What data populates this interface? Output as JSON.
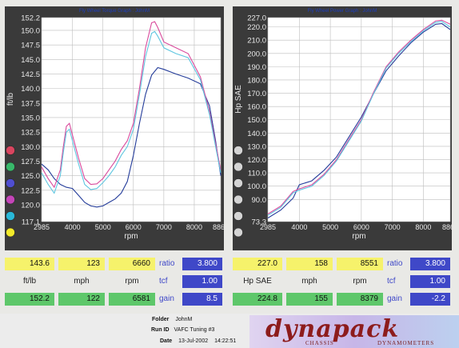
{
  "colors": {
    "panel_bg": "#3a3a3a",
    "plot_bg": "#ffffff",
    "series_1": "#243c9a",
    "series_2": "#d94a9c",
    "series_3": "#5fc6e0",
    "title_color": "#1f3fbf",
    "yellow": "#f6f26b",
    "green": "#5ec76a",
    "blue": "#3f48c8"
  },
  "legend_dots": [
    "#d9455f",
    "#38b86a",
    "#4f4ed0",
    "#c445b8",
    "#29b8d8",
    "#f2ea2a"
  ],
  "chart_data": [
    {
      "type": "line",
      "title": "Fly Wheel Torque Graph : JohnM",
      "xlabel": "rpm",
      "ylabel": "ft/lb",
      "xlim": [
        2985,
        8868
      ],
      "ylim": [
        117.1,
        152.2
      ],
      "x_ticks": [
        2985,
        4000,
        5000,
        6000,
        7000,
        8000,
        8868
      ],
      "x_tick_labels": [
        "2985",
        "4000",
        "5000",
        "6000",
        "7000",
        "8000",
        "8868"
      ],
      "y_ticks": [
        117.1,
        120.0,
        122.5,
        125.0,
        127.5,
        130.0,
        132.5,
        135.0,
        137.5,
        140.0,
        142.5,
        145.0,
        147.5,
        150.0,
        152.2
      ],
      "y_tick_labels": [
        "117.1",
        "120.0",
        "122.5",
        "125.0",
        "127.5",
        "130.0",
        "132.5",
        "135.0",
        "137.5",
        "140.0",
        "142.5",
        "145.0",
        "147.5",
        "150.0",
        "152.2"
      ],
      "grid": true,
      "series": [
        {
          "color": "#243c9a",
          "x": [
            2985,
            3200,
            3400,
            3600,
            3800,
            4000,
            4200,
            4400,
            4600,
            4800,
            5000,
            5200,
            5400,
            5600,
            5800,
            6000,
            6200,
            6400,
            6600,
            6800,
            7000,
            7400,
            7800,
            8200,
            8500,
            8700,
            8868
          ],
          "y": [
            127.0,
            126.0,
            124.5,
            123.5,
            123.0,
            122.8,
            121.6,
            120.4,
            119.8,
            119.6,
            119.8,
            120.4,
            121.0,
            122.0,
            124.0,
            128.5,
            134.0,
            139.0,
            142.3,
            143.6,
            143.3,
            142.5,
            141.8,
            140.8,
            137.0,
            131.0,
            125.0
          ]
        },
        {
          "color": "#d94a9c",
          "x": [
            2985,
            3200,
            3400,
            3600,
            3700,
            3800,
            3900,
            4000,
            4200,
            4400,
            4600,
            4800,
            5000,
            5200,
            5400,
            5600,
            5800,
            6000,
            6200,
            6400,
            6600,
            6700,
            6800,
            7000,
            7400,
            7800,
            8200,
            8500,
            8700,
            8868
          ],
          "y": [
            126.5,
            124.5,
            123.0,
            126.0,
            130.0,
            133.5,
            134.0,
            132.0,
            128.0,
            124.5,
            123.5,
            123.6,
            124.5,
            126.0,
            127.5,
            129.5,
            131.0,
            134.0,
            140.0,
            147.0,
            151.3,
            151.5,
            150.5,
            148.0,
            147.0,
            146.0,
            142.0,
            136.0,
            130.5,
            126.0
          ]
        },
        {
          "color": "#5fc6e0",
          "x": [
            2985,
            3200,
            3400,
            3600,
            3700,
            3800,
            3900,
            4000,
            4200,
            4400,
            4600,
            4800,
            5000,
            5200,
            5400,
            5600,
            5800,
            6000,
            6200,
            6400,
            6600,
            6700,
            6800,
            7000,
            7400,
            7800,
            8200,
            8500,
            8700,
            8868
          ],
          "y": [
            125.5,
            123.5,
            122.0,
            125.0,
            129.0,
            132.5,
            133.0,
            131.0,
            127.0,
            123.5,
            122.6,
            122.8,
            123.8,
            125.0,
            126.5,
            128.5,
            130.0,
            133.0,
            139.0,
            145.5,
            149.5,
            149.8,
            149.0,
            147.0,
            146.0,
            145.3,
            141.5,
            135.5,
            130.0,
            125.5
          ]
        }
      ]
    },
    {
      "type": "line",
      "title": "Fly Wheel Power Graph : JohnM",
      "xlabel": "rpm",
      "ylabel": "Hp SAE",
      "xlim": [
        2985,
        8868
      ],
      "ylim": [
        73.3,
        227.0
      ],
      "x_ticks": [
        2985,
        4000,
        5000,
        6000,
        7000,
        8000,
        8868
      ],
      "x_tick_labels": [
        "2985",
        "4000",
        "5000",
        "6000",
        "7000",
        "8000",
        "8868"
      ],
      "y_ticks": [
        73.3,
        90.0,
        100.0,
        110.0,
        120.0,
        130.0,
        140.0,
        150.0,
        160.0,
        170.0,
        180.0,
        190.0,
        200.0,
        210.0,
        220.0,
        227.0
      ],
      "y_tick_labels": [
        "73.3",
        "90.0",
        "100.0",
        "110.0",
        "120.0",
        "130.0",
        "140.0",
        "150.0",
        "160.0",
        "170.0",
        "180.0",
        "190.0",
        "200.0",
        "210.0",
        "220.0",
        "227.0"
      ],
      "grid": true,
      "series": [
        {
          "color": "#243c9a",
          "x": [
            2985,
            3400,
            3800,
            4000,
            4400,
            4800,
            5200,
            5600,
            6000,
            6400,
            6800,
            7200,
            7600,
            8000,
            8400,
            8600,
            8868
          ],
          "y": [
            76.0,
            82.0,
            91.0,
            101.0,
            104.0,
            112.0,
            122.0,
            137.0,
            152.0,
            170.0,
            187.0,
            198.0,
            208.0,
            216.0,
            222.0,
            222.5,
            218.0
          ]
        },
        {
          "color": "#d94a9c",
          "x": [
            2985,
            3400,
            3800,
            4000,
            4400,
            4800,
            5200,
            5600,
            6000,
            6400,
            6800,
            7200,
            7600,
            8000,
            8400,
            8600,
            8868
          ],
          "y": [
            79.0,
            85.0,
            96.0,
            98.0,
            101.0,
            109.0,
            120.0,
            135.0,
            150.0,
            171.0,
            190.0,
            201.0,
            210.0,
            218.0,
            224.5,
            225.0,
            222.0
          ]
        },
        {
          "color": "#5fc6e0",
          "x": [
            2985,
            3400,
            3800,
            4000,
            4400,
            4800,
            5200,
            5600,
            6000,
            6400,
            6800,
            7200,
            7600,
            8000,
            8400,
            8600,
            8868
          ],
          "y": [
            78.0,
            84.0,
            95.0,
            97.0,
            100.0,
            108.0,
            119.0,
            134.0,
            149.0,
            170.0,
            189.0,
            200.0,
            209.0,
            217.0,
            223.5,
            224.0,
            220.0
          ]
        }
      ]
    }
  ],
  "stats_left": {
    "row1": [
      "143.6",
      "123",
      "6660"
    ],
    "row2": [
      "ft/lb",
      "mph",
      "rpm"
    ],
    "row3": [
      "152.2",
      "122",
      "6581"
    ],
    "labels": [
      "ratio",
      "tcf",
      "gain"
    ],
    "values": [
      "3.800",
      "1.00",
      "8.5"
    ]
  },
  "stats_right": {
    "row1": [
      "227.0",
      "158",
      "8551"
    ],
    "row2": [
      "Hp SAE",
      "mph",
      "rpm"
    ],
    "row3": [
      "224.8",
      "155",
      "8379"
    ],
    "labels": [
      "ratio",
      "tcf",
      "gain"
    ],
    "values": [
      "3.800",
      "1.00",
      "-2.2"
    ]
  },
  "footer": {
    "folder_label": "Folder",
    "folder_value": "JohnM",
    "runid_label": "Run ID",
    "runid_value": "VAFC Tuning #3",
    "date_label": "Date",
    "date_value": "13-Jul-2002",
    "time_value": "14:22:51",
    "logo_word": "dynapack",
    "logo_sub_left": "CHASSIS",
    "logo_sub_right": "DYNAMOMETERS"
  }
}
